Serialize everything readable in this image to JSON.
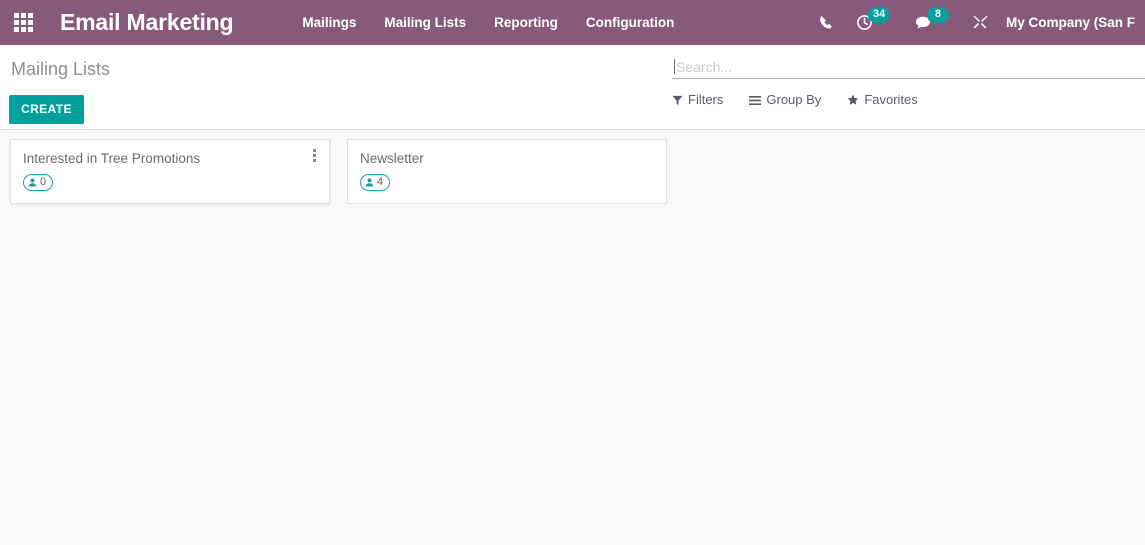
{
  "navbar": {
    "apps_icon": "apps-grid-icon",
    "brand": "Email Marketing",
    "menu": [
      {
        "label": "Mailings",
        "name": "menu-mailings"
      },
      {
        "label": "Mailing Lists",
        "name": "menu-mailing-lists"
      },
      {
        "label": "Reporting",
        "name": "menu-reporting"
      },
      {
        "label": "Configuration",
        "name": "menu-configuration"
      }
    ],
    "systray": {
      "phone_icon": "phone-icon",
      "activity_icon": "clock-activity-icon",
      "activity_count": "34",
      "messages_icon": "chat-bubble-icon",
      "messages_count": "8",
      "tools_icon": "crossed-tools-icon",
      "company": "My Company (San F"
    },
    "colors": {
      "bar": "#875a7b",
      "badge": "#00a09d"
    }
  },
  "control_panel": {
    "breadcrumb": "Mailing Lists",
    "create_label": "CREATE",
    "create_color": "#00a09d",
    "search": {
      "value": "",
      "placeholder": "Search..."
    },
    "filter_buttons": [
      {
        "label": "Filters",
        "icon": "funnel-icon",
        "name": "filters-button"
      },
      {
        "label": "Group By",
        "icon": "list-lines-icon",
        "name": "group-by-button"
      },
      {
        "label": "Favorites",
        "icon": "star-icon",
        "name": "favorites-button"
      }
    ]
  },
  "kanban": {
    "cards": [
      {
        "title": "Interested in Tree Promotions",
        "contact_count": "0",
        "badge_icon": "person-icon",
        "has_menu": true
      },
      {
        "title": "Newsletter",
        "contact_count": "4",
        "badge_icon": "person-icon",
        "has_menu": false
      }
    ],
    "badge_border_color": "#1ba39c"
  }
}
